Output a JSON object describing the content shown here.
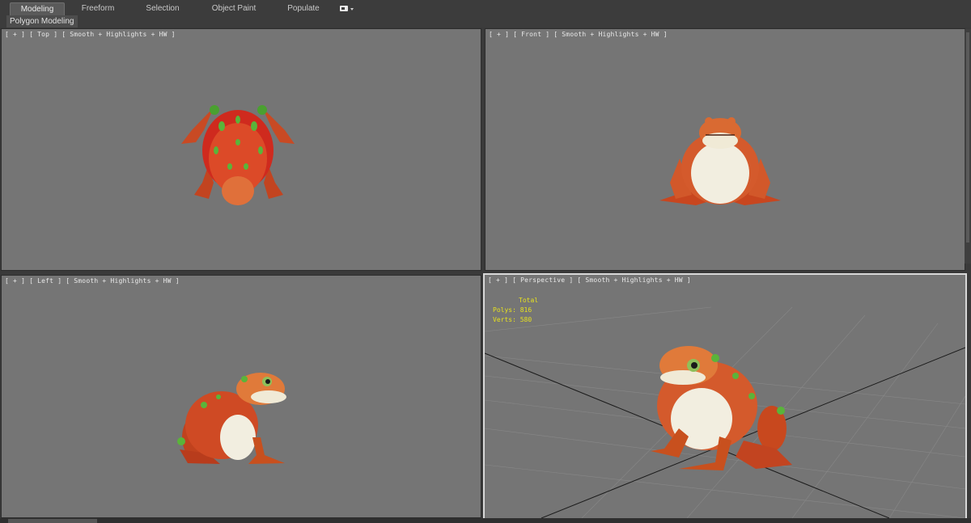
{
  "ribbon": {
    "tabs": [
      {
        "label": "Modeling",
        "active": true
      },
      {
        "label": "Freeform",
        "active": false
      },
      {
        "label": "Selection",
        "active": false
      },
      {
        "label": "Object Paint",
        "active": false
      },
      {
        "label": "Populate",
        "active": false
      }
    ],
    "extra_icon": "camera-dropdown-icon",
    "subpanel_label": "Polygon Modeling"
  },
  "viewports": {
    "top": {
      "label": "[ + ] [ Top ] [ Smooth + Highlights + HW ]"
    },
    "front": {
      "label": "[ + ] [ Front ] [ Smooth + Highlights + HW ]"
    },
    "left": {
      "label": "[ + ] [ Left ] [ Smooth + Highlights + HW ]"
    },
    "perspective": {
      "label": "[ + ] [ Perspective ] [ Smooth + Highlights + HW ]",
      "stats": {
        "total_label": "Total",
        "polys_label": "Polys:",
        "polys_value": "816",
        "verts_label": "Verts:",
        "verts_value": "580"
      }
    }
  },
  "colors": {
    "viewport_bg": "#757575",
    "ui_dark": "#3c3c3c",
    "stats_text": "#e6e020",
    "toad_skin": "#d9542a",
    "toad_belly": "#f2eee0",
    "toad_spots": "#5ab43a"
  }
}
